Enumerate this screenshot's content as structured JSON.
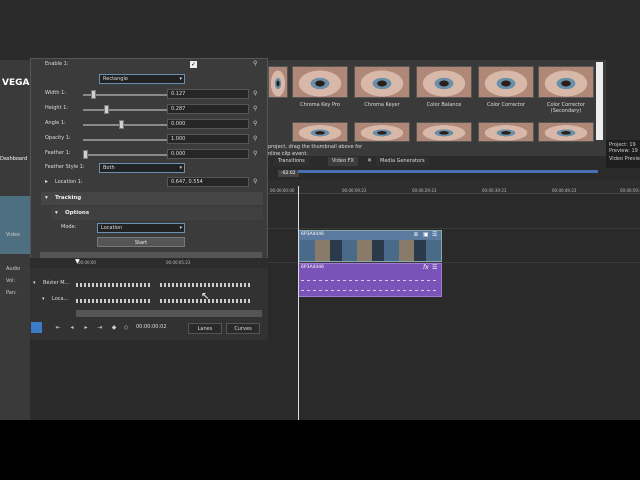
{
  "app": {
    "logo": "VEGAS",
    "dashboard": "Dashboard"
  },
  "left_labels": {
    "video": "Video",
    "audio": "Audio",
    "vol": "Vol:",
    "pan": "Pan:"
  },
  "fx_panel": {
    "enable_label": "Enable 1:",
    "shape_value": "Rectangle",
    "params": [
      {
        "label": "Width 1:",
        "value": "0.127",
        "level": 0.08
      },
      {
        "label": "Height 1:",
        "value": "0.287",
        "level": 0.2
      },
      {
        "label": "Angle 1:",
        "value": "0.000",
        "level": 0.35
      },
      {
        "label": "Opacity 1:",
        "value": "1.000",
        "level": 0.98
      },
      {
        "label": "Feather 1:",
        "value": "0.000",
        "level": 0.0
      }
    ],
    "feather_style_label": "Feather Style 1:",
    "feather_style_value": "Both",
    "location_label": "Location 1:",
    "location_value": "0.647, 0.554",
    "tracking_label": "Tracking",
    "options_label": "Options",
    "mode_label": "Mode:",
    "mode_value": "Location",
    "start_label": "Start"
  },
  "keyframes": {
    "time_start": "00:00:00",
    "time_mid": "00:00:05:23",
    "row1_label": "Bézier M...",
    "row2_label": "Loca...",
    "timecode": "00:00:00:02",
    "lanes_label": "Lanes",
    "curves_label": "Curves"
  },
  "browser": {
    "thumbs": [
      "Chroma Key Pro",
      "Chroma Keyer",
      "Color Balance",
      "Color Corrector",
      "Color Corrector (Secondary)"
    ],
    "hint_line1": "project, drag the thumbnail above for",
    "hint_line2": "nline clip event.",
    "tabs": [
      "Transitions",
      "Video FX",
      "Media Generators"
    ]
  },
  "right_panel": {
    "project": "Project:  19",
    "preview": "Preview:  19",
    "video_preview": "Video Previe"
  },
  "timeline": {
    "marker": "-02:02",
    "ticks": [
      "00:00:00:00",
      "00:00:09:23",
      "00:00:29:23",
      "00:00:39:23",
      "00:00:49:23",
      "00:00:59:23"
    ],
    "video_event": "6P3A4446",
    "audio_event": "6P3A4446",
    "fx_label": "fx"
  }
}
